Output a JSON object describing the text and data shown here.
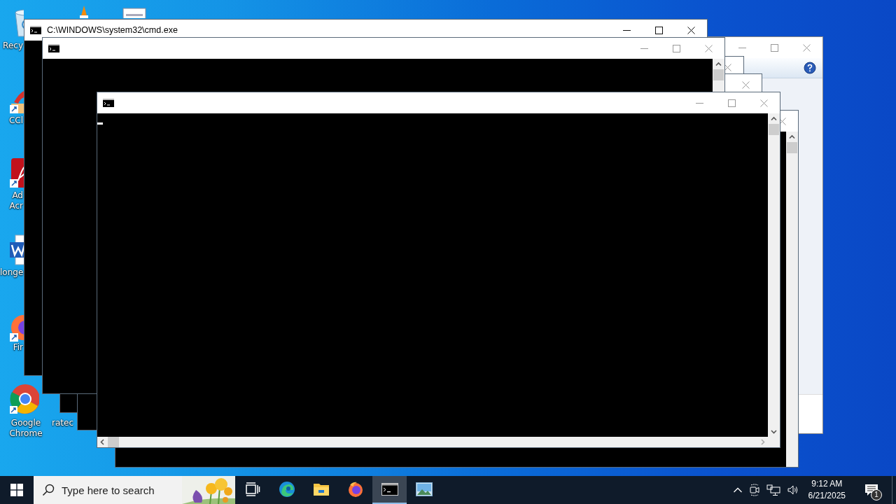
{
  "desktop": {
    "icons": [
      {
        "kind": "recycle-bin",
        "lines": [
          "Recy"
        ]
      },
      {
        "kind": "vlc"
      },
      {
        "kind": "document"
      },
      {
        "kind": "ccleaner",
        "lines": [
          "CCl"
        ]
      },
      {
        "kind": "acrobat",
        "lines": [
          "Ad",
          "Acr"
        ]
      },
      {
        "kind": "word",
        "lines": [
          "longe"
        ]
      },
      {
        "kind": "firefox",
        "lines": [
          "Fir"
        ]
      },
      {
        "kind": "chrome",
        "lines": [
          "Google",
          "Chrome"
        ]
      },
      {
        "kind": "hidden",
        "lines": [
          "ratec"
        ]
      }
    ]
  },
  "windows": [
    {
      "kind": "dialog",
      "active": false
    },
    {
      "kind": "stub"
    },
    {
      "kind": "stub"
    },
    {
      "kind": "stub"
    },
    {
      "kind": "console",
      "title": "C:\\WINDOWS\\system32\\cmd.exe",
      "active": true,
      "cursor": false
    },
    {
      "kind": "console",
      "active": false,
      "cursor": false
    },
    {
      "kind": "console",
      "active": false,
      "cursor": true
    }
  ],
  "taskbar": {
    "search": {
      "placeholder": "Type here to search"
    },
    "apps": [
      {
        "kind": "task-view",
        "selected": false
      },
      {
        "kind": "edge",
        "selected": false
      },
      {
        "kind": "explorer",
        "selected": false
      },
      {
        "kind": "firefox",
        "selected": false
      },
      {
        "kind": "console",
        "selected": true
      },
      {
        "kind": "photos",
        "selected": false
      }
    ],
    "clock": {
      "time": "9:12 AM",
      "date": "6/21/2025"
    },
    "notifications": {
      "count": "1"
    }
  }
}
